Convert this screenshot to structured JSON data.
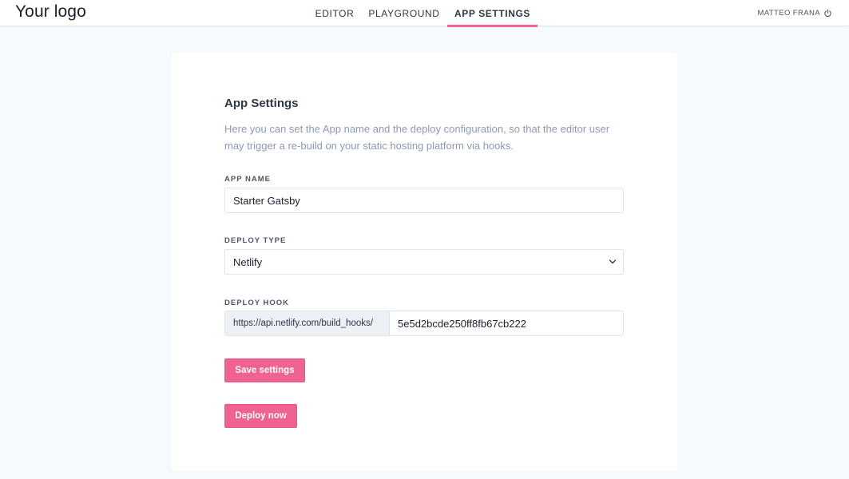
{
  "header": {
    "logo": "Your logo",
    "tabs": [
      {
        "label": "EDITOR",
        "active": false
      },
      {
        "label": "PLAYGROUND",
        "active": false
      },
      {
        "label": "APP SETTINGS",
        "active": true
      }
    ],
    "user_name": "MATTEO FRANA",
    "logout_icon": "power-icon"
  },
  "settings": {
    "title": "App Settings",
    "description": "Here you can set the App name and the deploy configuration, so that the editor user may trigger a re-build on your static hosting platform via hooks.",
    "app_name": {
      "label": "APP NAME",
      "value": "Starter Gatsby"
    },
    "deploy_type": {
      "label": "DEPLOY TYPE",
      "selected": "Netlify"
    },
    "deploy_hook": {
      "label": "DEPLOY HOOK",
      "prefix": "https://api.netlify.com/build_hooks/",
      "value": "5e5d2bcde250ff8fb67cb222"
    },
    "save_label": "Save settings",
    "deploy_label": "Deploy now"
  },
  "colors": {
    "accent": "#f06292",
    "background": "#f7fafc",
    "muted_text": "#8d9ab0"
  }
}
